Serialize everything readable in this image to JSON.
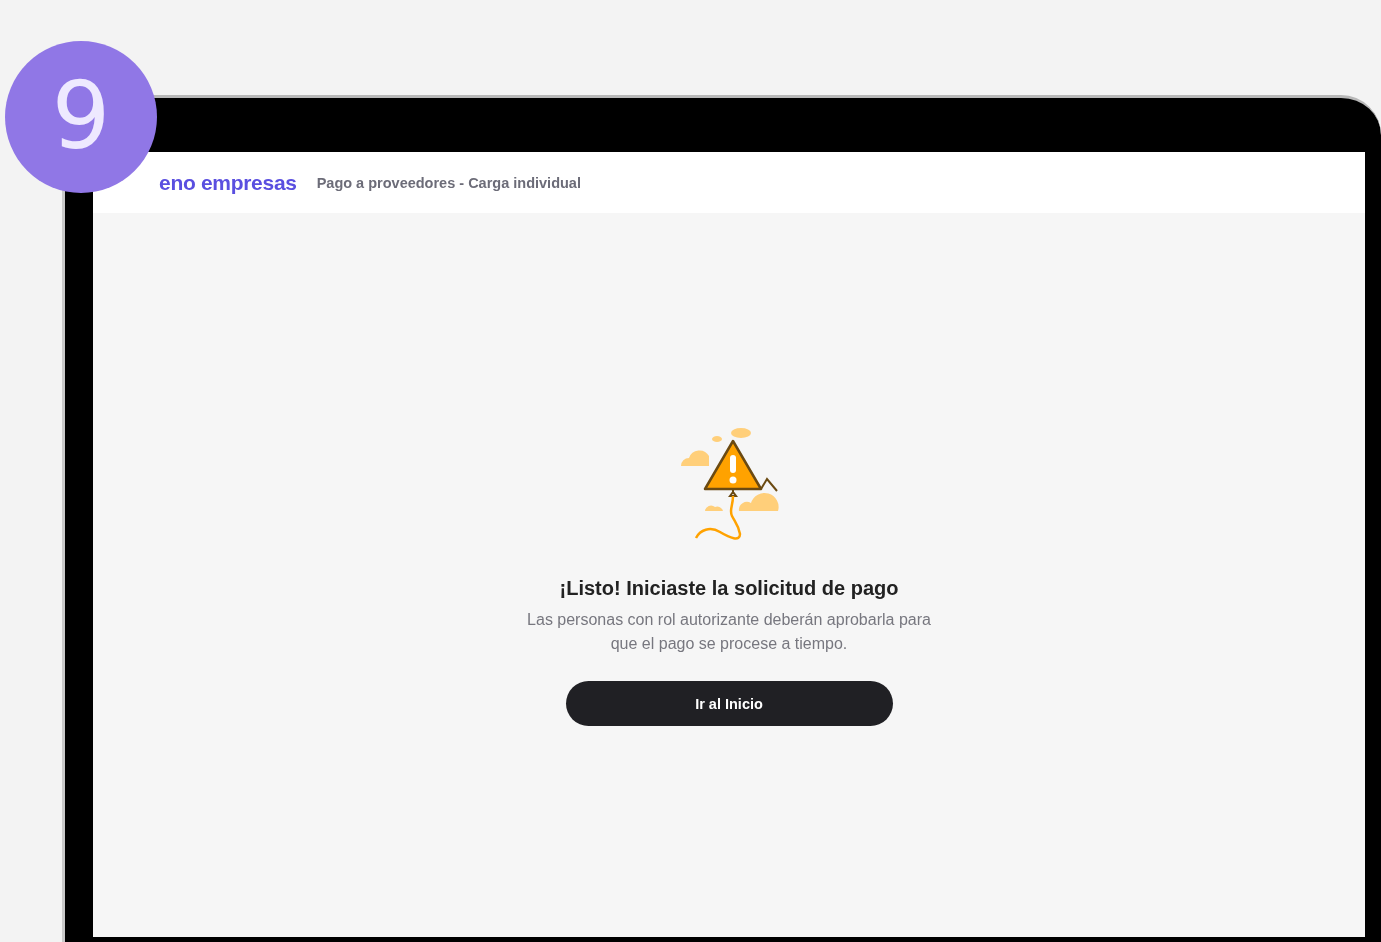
{
  "step_badge": "9",
  "header": {
    "logo": "eno empresas",
    "title": "Pago a proveedores - Carga individual"
  },
  "message": {
    "title": "¡Listo! Iniciaste la solicitud de pago",
    "body": "Las personas con rol autorizante deberán aprobarla para que el pago se procese a tiempo.",
    "button": "Ir al Inicio"
  }
}
